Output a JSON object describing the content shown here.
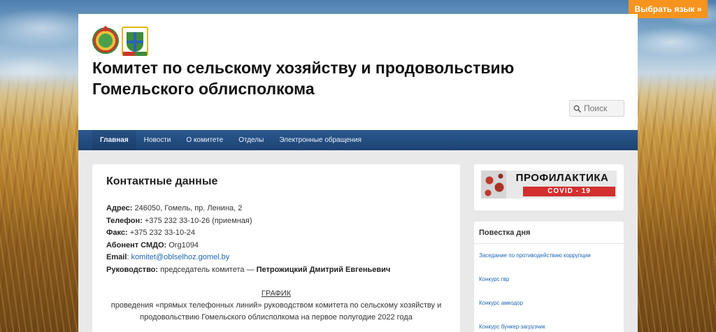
{
  "lang_button": "Выбрать язык »",
  "site": {
    "title_line1": "Комитет по сельскому хозяйству и продовольствию",
    "title_line2": "Гомельского облисполкома"
  },
  "search": {
    "placeholder": "Поиск"
  },
  "nav": {
    "items": [
      {
        "label": "Главная",
        "active": true
      },
      {
        "label": "Новости"
      },
      {
        "label": "О комитете"
      },
      {
        "label": "Отделы"
      },
      {
        "label": "Электронные обращения"
      }
    ]
  },
  "content": {
    "heading": "Контактные данные",
    "address": {
      "label": "Адрес:",
      "value": " 246050, Гомель, пр. Ленина, 2"
    },
    "phone": {
      "label": "Телефон:",
      "value": " +375 232 33-10-26 (приемная)"
    },
    "fax": {
      "label": "Факс:",
      "value": " +375 232 33-10-24"
    },
    "smdo": {
      "label": "Абонент СМДО:",
      "value": " Org1094"
    },
    "email": {
      "label": "Email",
      "sep": ": ",
      "value": "komitet@oblselhoz.gomel.by"
    },
    "head": {
      "label": "Руководство:",
      "value": " председатель комитета — ",
      "name": "Петрожицкий Дмитрий Евгеньевич"
    },
    "schedule": {
      "title": "ГРАФИК",
      "line1": "проведения «прямых телефонных линий» руководством комитета по сельскому хозяйству и",
      "line2": "продовольствию Гомельского облисполкома на первое полугодие 2022 года"
    }
  },
  "sidebar": {
    "banner": {
      "top": "ПРОФИЛАКТИКА",
      "bottom": "COVID - 19"
    },
    "agenda": {
      "title": "Повестка дня",
      "items": [
        "Заседание по противодействию коррупции",
        "Конкурс гвр",
        "Конкурс амкодор",
        "Конкурс бункер-загрузчик"
      ]
    }
  },
  "colors": {
    "accent_orange": "#f7941d",
    "nav_blue": "#1d4373",
    "link_blue": "#1e66b5",
    "covid_red": "#d32f2f"
  }
}
